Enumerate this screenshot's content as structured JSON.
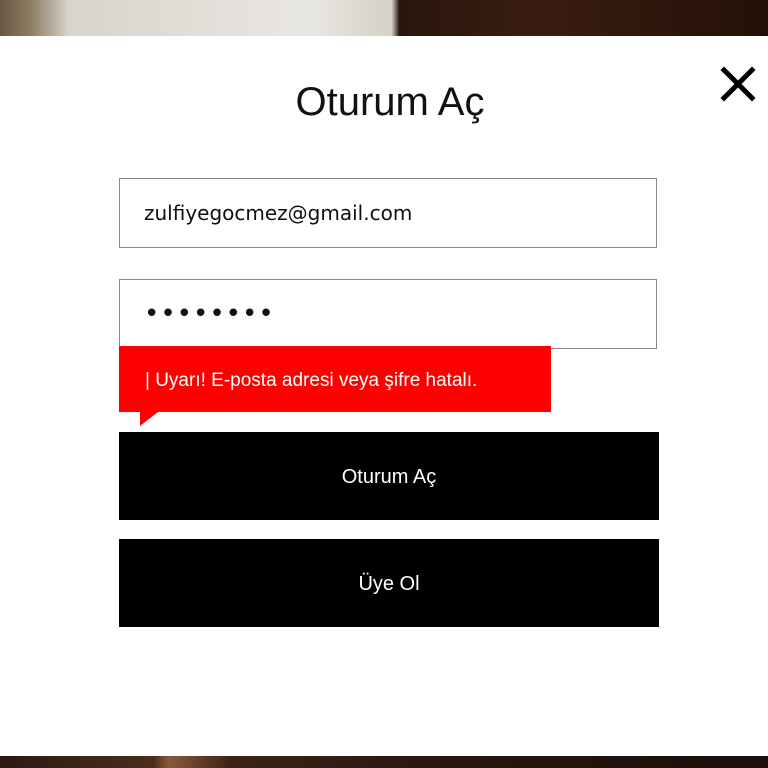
{
  "modal": {
    "title": "Oturum Aç",
    "close_icon": "close-icon"
  },
  "form": {
    "email_value": "zulfiyegocmez@gmail.com",
    "password_masked": "••••••••",
    "error_message": "| Uyarı! E-posta adresi veya şifre hatalı.",
    "login_label": "Oturum Aç",
    "register_label": "Üye Ol"
  },
  "colors": {
    "error": "#ff0000",
    "button": "#000000",
    "modal_background": "#ffffff"
  }
}
